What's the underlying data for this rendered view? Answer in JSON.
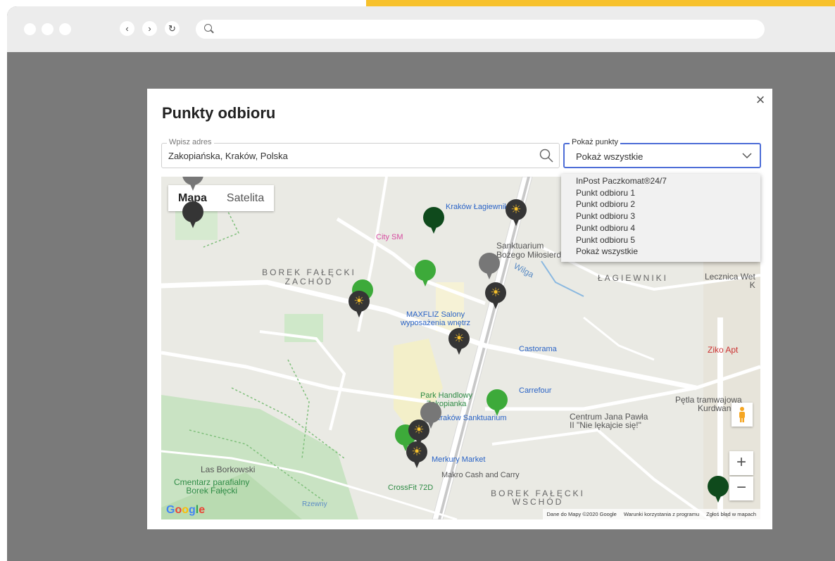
{
  "modal": {
    "title": "Punkty odbioru",
    "close_label": "×",
    "address": {
      "label": "Wpisz adres",
      "value": "Zakopiańska, Kraków, Polska"
    },
    "filter": {
      "label": "Pokaż punkty",
      "selected": "Pokaż wszystkie",
      "options": [
        "InPost Paczkomat®24/7",
        "Punkt odbioru 1",
        "Punkt odbioru 2",
        "Punkt odbioru 3",
        "Punkt odbioru 4",
        "Punkt odbioru 5",
        "Pokaż wszystkie"
      ]
    }
  },
  "map": {
    "tabs": [
      "Mapa",
      "Satelita"
    ],
    "active_tab": "Mapa",
    "labels": {
      "borek_zachod": "BOREK FAŁĘCKI\nZACHÓD",
      "lagiewniki": "ŁAGIEWNIKI",
      "borek_wschod": "BOREK FAŁĘCKI\nWSCHÓD",
      "sanktuarium": "Sanktuarium\nBożego Miłosierdzia",
      "las": "Las Borkowski",
      "cmentarz": "Cmentarz parafialny\nBorek Fałęcki",
      "wilga": "Wilga",
      "rzewny": "Rzewny",
      "petla": "Pętla tramwajowa\nKurdwanów",
      "centrum": "Centrum Jana Pawła\nII \"Nie lękajcie się!\"",
      "lecznica": "Lecznica Wet\nK"
    },
    "pois": {
      "kl": "Kraków Łagiewniki",
      "citysm": "City SM",
      "maxfliz": "MAXFLIZ Salony\nwyposażenia wnętrz",
      "castorama": "Castorama",
      "park": "Park Handlowy\nZakopianka",
      "carrefour": "Carrefour",
      "ks": "Kraków Sanktuarium",
      "merkury": "Merkury Market",
      "makro": "Makro Cash and Carry",
      "crossfit": "CrossFit 72D",
      "ziko": "Ziko Apt"
    },
    "zoom_in": "+",
    "zoom_out": "−",
    "google": "Google",
    "attribution": [
      "Dane do Mapy ©2020 Google",
      "Warunki korzystania z programu",
      "Zgłoś błąd w mapach"
    ],
    "colors": {
      "dark_pin": "#353535",
      "grey_pin": "#777777",
      "green_pin": "#3daa3a",
      "dark_green_pin": "#0f4a1c",
      "accent": "#f7c12c"
    }
  }
}
